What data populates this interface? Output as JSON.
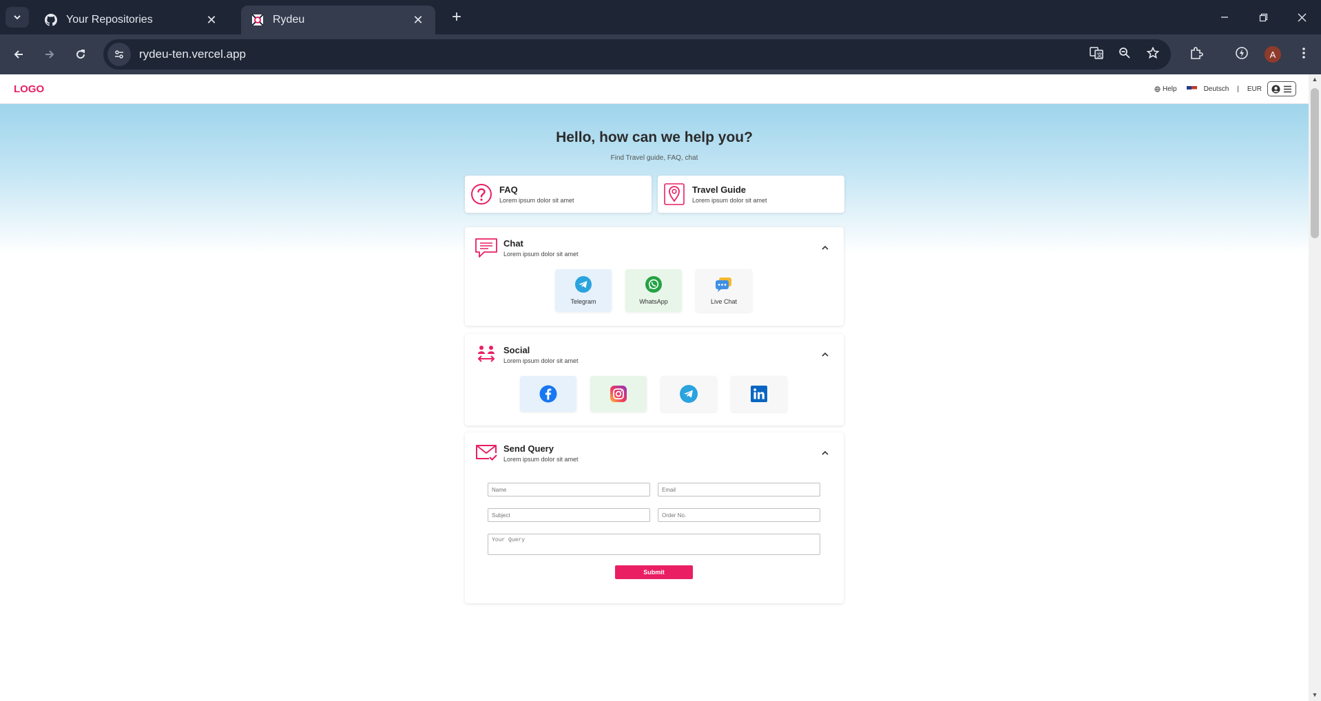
{
  "browser": {
    "tabs": [
      {
        "title": "Your Repositories",
        "icon": "github-icon"
      },
      {
        "title": "Rydeu",
        "icon": "rydeu-favicon"
      }
    ],
    "url": "rydeu-ten.vercel.app",
    "profile_initial": "A"
  },
  "header": {
    "logo": "LOGO",
    "help": "Help",
    "language": "Deutsch",
    "separator": "|",
    "currency": "EUR"
  },
  "hero": {
    "title": "Hello, how can we help you?",
    "subtitle": "Find Travel guide, FAQ, chat"
  },
  "quick_links": [
    {
      "title": "FAQ",
      "desc": "Lorem ipsum dolor sit amet",
      "icon": "question-circle-icon"
    },
    {
      "title": "Travel Guide",
      "desc": "Lorem ipsum dolor sit amet",
      "icon": "map-pin-icon"
    }
  ],
  "chat": {
    "title": "Chat",
    "desc": "Lorem ipsum dolor sit amet",
    "options": [
      {
        "label": "Telegram",
        "icon": "telegram-icon",
        "bg": "#e6f1fb"
      },
      {
        "label": "WhatsApp",
        "icon": "whatsapp-icon",
        "bg": "#e8f5e9"
      },
      {
        "label": "Live Chat",
        "icon": "live-chat-icon",
        "bg": "#f7f7f7"
      }
    ]
  },
  "social": {
    "title": "Social",
    "desc": "Lorem ipsum dolor sit amet",
    "links": [
      {
        "icon": "facebook-icon",
        "bg": "#e6f1fb"
      },
      {
        "icon": "instagram-icon",
        "bg": "#e8f5e9"
      },
      {
        "icon": "telegram-icon",
        "bg": "#f7f7f7"
      },
      {
        "icon": "linkedin-icon",
        "bg": "#f7f7f7"
      }
    ]
  },
  "query": {
    "title": "Send Query",
    "desc": "Lorem ipsum dolor sit amet",
    "name_placeholder": "Name",
    "email_placeholder": "Email",
    "subject_placeholder": "Subject",
    "order_placeholder": "Order No.",
    "query_placeholder": "Your Query",
    "submit_label": "Submit"
  },
  "colors": {
    "accent": "#e91e63",
    "browser_frame": "#1e2535",
    "hero_gradient_top": "#8fcde8"
  }
}
